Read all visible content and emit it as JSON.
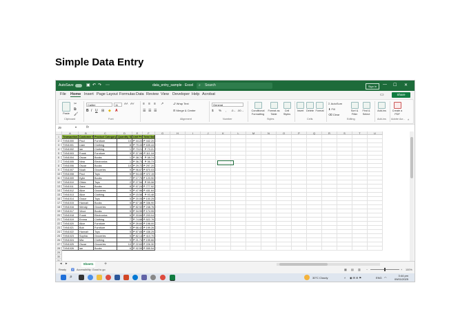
{
  "slide": {
    "title": "Simple Data Entry"
  },
  "window": {
    "autosave_label": "AutoSave",
    "file_name": "data_entry_sample · Excel",
    "search_placeholder": "Search",
    "sign_in": "Sign in",
    "minimize": "—",
    "maximize": "☐",
    "close": "✕"
  },
  "menu": {
    "items": [
      "File",
      "Home",
      "Insert",
      "Page Layout",
      "Formulas",
      "Data",
      "Review",
      "View",
      "Developer",
      "Help",
      "Acrobat"
    ],
    "share_label": "Share"
  },
  "ribbon": {
    "paste": "Paste",
    "font_name": "Calibri",
    "font_size": "11",
    "wrap_text": "Wrap Text",
    "merge_center": "Merge & Center",
    "number_format": "General",
    "conditional_formatting": "Conditional Formatting",
    "format_as_table": "Format as Table",
    "cell_styles": "Cell Styles",
    "insert": "Insert",
    "delete": "Delete",
    "format": "Format",
    "autosum": "AutoSum",
    "fill": "Fill",
    "clear": "Clear",
    "sort_filter": "Sort & Filter",
    "find_select": "Find & Select",
    "add_ins": "Add-ins",
    "create_pdf": "Create a PDF",
    "groups": [
      "Clipboard",
      "Font",
      "Alignment",
      "Number",
      "Styles",
      "Cells",
      "Editing",
      "Add-ins",
      "Adobe Acr..."
    ]
  },
  "formula_bar": {
    "name_box": "J9",
    "fx": "fx",
    "value": ""
  },
  "sheet": {
    "columns": [
      "A",
      "B",
      "C",
      "D",
      "E",
      "F",
      "G",
      "H",
      "I",
      "J",
      "K",
      "L",
      "M",
      "N",
      "O",
      "P",
      "Q",
      "R",
      "S",
      "T",
      "U"
    ],
    "header_row": [
      "Transaction ID",
      "Customer Name",
      "Product Category",
      "Quantity Sold",
      "Unit Price",
      "Total Sales"
    ],
    "rows": [
      [
        "TXN1000",
        "Paul",
        "Furniture",
        "10",
        "₱ 44.22",
        "₱ 442.20"
      ],
      [
        "TXN1001",
        "Liam",
        "Clothing",
        "8",
        "₱ 79.43",
        "₱ 635.44"
      ],
      [
        "TXN1002",
        "Ian",
        "Clothing",
        "1",
        "₱ 73.21",
        "₱ 73.21"
      ],
      [
        "TXN1003",
        "Frank",
        "Furniture",
        "3",
        "₱ 37.06",
        "₱ 111.18"
      ],
      [
        "TXN1004",
        "Oscar",
        "Books",
        "1",
        "₱ 38.74",
        "₱ 38.74"
      ],
      [
        "TXN1005",
        "Nina",
        "Electronics",
        "1",
        "₱ 36.73",
        "₱ 36.73"
      ],
      [
        "TXN1006",
        "Oscar",
        "Books",
        "10",
        "₱ 29.72",
        "₱ 297.20"
      ],
      [
        "TXN1007",
        "Noah",
        "Groceries",
        "9",
        "₱ 96.67",
        "₱ 870.03"
      ],
      [
        "TXN1008",
        "Paul",
        "Toys",
        "5",
        "₱ 94.43",
        "₱ 472.15"
      ],
      [
        "TXN1009",
        "Kylie",
        "Books",
        "7",
        "₱ 17.70",
        "₱ 123.90"
      ],
      [
        "TXN1010",
        "Olivia",
        "Toys",
        "2",
        "₱ 27.54",
        "₱ 55.08"
      ],
      [
        "TXN1011",
        "Zane",
        "Books",
        "8",
        "₱ 97.24",
        "₱ 777.92"
      ],
      [
        "TXN1012",
        "Alice",
        "Groceries",
        "9",
        "₱ 47.96",
        "₱ 431.64"
      ],
      [
        "TXN1013",
        "Alice",
        "Clothing",
        "6",
        "₱ 15.58",
        "₱ 93.48"
      ],
      [
        "TXN1014",
        "Grace",
        "Toys",
        "5",
        "₱ 20.05",
        "₱ 100.25"
      ],
      [
        "TXN1015",
        "Hannah",
        "Books",
        "5",
        "₱ 67.38",
        "₱ 336.90"
      ],
      [
        "TXN1016",
        "Wendy",
        "Groceries",
        "3",
        "₱ 82.92",
        "₱ 248.76"
      ],
      [
        "TXN1017",
        "Vince",
        "Books",
        "5",
        "₱ 34.99",
        "₱ 174.95"
      ],
      [
        "TXN1018",
        "Frank",
        "Electronics",
        "6",
        "₱ 33.84",
        "₱ 203.04"
      ],
      [
        "TXN1019",
        "Emma",
        "Clothing",
        "7",
        "₱ 74.68",
        "₱ 522.76"
      ],
      [
        "TXN1020",
        "Alice",
        "Furniture",
        "5",
        "₱ 39.60",
        "₱ 198.00"
      ],
      [
        "TXN1021",
        "Bob",
        "Furniture",
        "3",
        "₱ 66.42",
        "₱ 199.26"
      ],
      [
        "TXN1022",
        "Hannah",
        "Toys",
        "5",
        "₱ 87.65",
        "₱ 438.25"
      ],
      [
        "TXN1023",
        "Sophia",
        "Groceries",
        "5",
        "₱ 82.14",
        "₱ 410.70"
      ],
      [
        "TXN1024",
        "Mia",
        "Clothing",
        "9",
        "₱ 21.74",
        "₱ 195.66"
      ],
      [
        "TXN1025",
        "Oscar",
        "Groceries",
        "10",
        "₱ 22.63",
        "₱ 226.30"
      ],
      [
        "TXN1026",
        "Ian",
        "Books",
        "6",
        "₱ 92.59",
        "₱ 555.54"
      ]
    ],
    "tab_name": "Sheet1",
    "add_sheet": "+"
  },
  "status": {
    "ready": "Ready",
    "accessibility": "Accessibility: Good to go",
    "zoom": "100%"
  },
  "taskbar": {
    "weather": "30°C  Cloudy",
    "lang": "ENG",
    "time": "3:44 pm",
    "date": "09/01/2025"
  }
}
